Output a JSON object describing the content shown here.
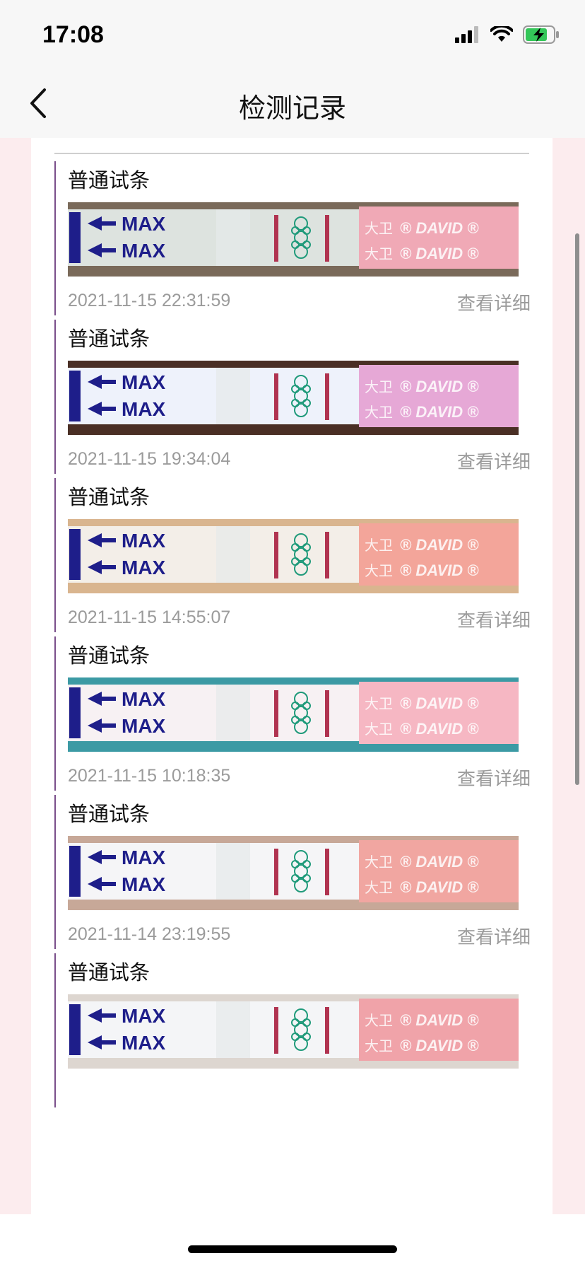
{
  "status_bar": {
    "time": "17:08",
    "icons": [
      "signal-icon",
      "wifi-icon",
      "battery-charging-icon"
    ]
  },
  "header": {
    "title": "检测记录",
    "back_icon": "chevron-left-icon"
  },
  "colors": {
    "accent_line": "#7a4f8a",
    "page_bg": "#fcecee",
    "strip_pink": "#f2a7b5",
    "control_line": "#b03350",
    "strip_handle": "#1e1e8a"
  },
  "records": [
    {
      "type": "普通试条",
      "date": "2021-11-15 22:31:59",
      "detail": "查看详细",
      "strip_text": "MAX",
      "brand_text": "DAVID",
      "brand_cn": "大卫"
    },
    {
      "type": "普通试条",
      "date": "2021-11-15 19:34:04",
      "detail": "查看详细",
      "strip_text": "MAX",
      "brand_text": "DAVID",
      "brand_cn": "大卫"
    },
    {
      "type": "普通试条",
      "date": "2021-11-15 14:55:07",
      "detail": "查看详细",
      "strip_text": "MAX",
      "brand_text": "DAVID",
      "brand_cn": "大卫"
    },
    {
      "type": "普通试条",
      "date": "2021-11-15 10:18:35",
      "detail": "查看详细",
      "strip_text": "MAX",
      "brand_text": "DAVID",
      "brand_cn": "大卫"
    },
    {
      "type": "普通试条",
      "date": "2021-11-14 23:19:55",
      "detail": "查看详细",
      "strip_text": "MAX",
      "brand_text": "DAVID",
      "brand_cn": "大卫"
    },
    {
      "type": "普通试条",
      "date": "",
      "detail": "",
      "strip_text": "MAX",
      "brand_text": "DAVID",
      "brand_cn": "大卫"
    }
  ]
}
